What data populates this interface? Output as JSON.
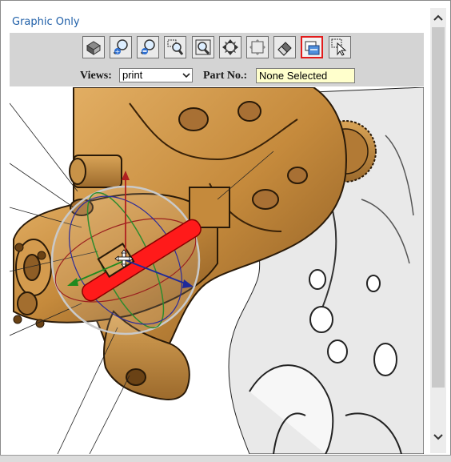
{
  "panel": {
    "title": "Graphic Only"
  },
  "toolbar": {
    "buttons": [
      {
        "name": "home-view",
        "icon": "home-box-icon"
      },
      {
        "name": "zoom-in",
        "icon": "zoom-in-icon"
      },
      {
        "name": "zoom-out",
        "icon": "zoom-out-icon"
      },
      {
        "name": "zoom-area",
        "icon": "zoom-area-icon"
      },
      {
        "name": "zoom-fit",
        "icon": "zoom-fit-icon"
      },
      {
        "name": "pan",
        "icon": "pan-arrows-icon"
      },
      {
        "name": "fit-all",
        "icon": "fit-all-icon"
      },
      {
        "name": "eraser",
        "icon": "eraser-icon"
      },
      {
        "name": "move-part",
        "icon": "move-part-icon",
        "active": true
      },
      {
        "name": "select",
        "icon": "select-cursor-icon"
      }
    ],
    "views_label": "Views:",
    "views_value": "print",
    "part_label": "Part No.:",
    "part_value": "None Selected"
  },
  "colors": {
    "title": "#1f5fa8",
    "active_border": "#e21b1b",
    "part_field_bg": "#ffffcc",
    "engine": "#c58a3c"
  }
}
